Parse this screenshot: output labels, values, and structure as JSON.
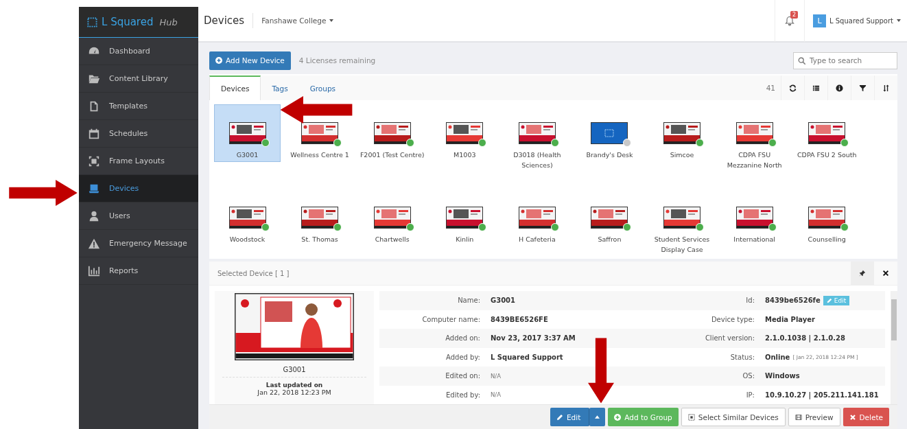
{
  "brand": {
    "name": "L Squared",
    "suffix": "Hub"
  },
  "sidebar": {
    "items": [
      {
        "label": "Dashboard",
        "selected": false
      },
      {
        "label": "Content Library",
        "selected": false
      },
      {
        "label": "Templates",
        "selected": false
      },
      {
        "label": "Schedules",
        "selected": false
      },
      {
        "label": "Frame Layouts",
        "selected": false
      },
      {
        "label": "Devices",
        "selected": true
      },
      {
        "label": "Users",
        "selected": false
      },
      {
        "label": "Emergency Message",
        "selected": false
      },
      {
        "label": "Reports",
        "selected": false
      }
    ]
  },
  "header": {
    "title": "Devices",
    "org": "Fanshawe College",
    "notifications": "2",
    "avatar": "L",
    "user": "L Squared Support"
  },
  "toolbar": {
    "add_button": "Add New Device",
    "licenses": "4 Licenses remaining",
    "search": {
      "placeholder": "Type to search"
    }
  },
  "tabs": [
    {
      "label": "Devices",
      "selected": true
    },
    {
      "label": "Tags",
      "selected": false
    },
    {
      "label": "Groups",
      "selected": false
    }
  ],
  "count": "41",
  "devices": [
    {
      "name": "G3001",
      "online": true,
      "selected": true
    },
    {
      "name": "Wellness Centre 1",
      "online": true,
      "selected": false
    },
    {
      "name": "F2001 (Test Centre)",
      "online": true,
      "selected": false
    },
    {
      "name": "M1003",
      "online": true,
      "selected": false
    },
    {
      "name": "D3018 (Health Sciences)",
      "online": true,
      "selected": false
    },
    {
      "name": "Brandy's Desk",
      "online": false,
      "selected": false
    },
    {
      "name": "Simcoe",
      "online": true,
      "selected": false
    },
    {
      "name": "CDPA FSU Mezzanine North",
      "online": true,
      "selected": false
    },
    {
      "name": "CDPA FSU 2 South",
      "online": true,
      "selected": false
    },
    {
      "name": "Woodstock",
      "online": true,
      "selected": false
    },
    {
      "name": "St. Thomas",
      "online": true,
      "selected": false
    },
    {
      "name": "Chartwells",
      "online": true,
      "selected": false
    },
    {
      "name": "Kinlin",
      "online": true,
      "selected": false
    },
    {
      "name": "H Cafeteria",
      "online": true,
      "selected": false
    },
    {
      "name": "Saffron",
      "online": true,
      "selected": false
    },
    {
      "name": "Student Services Display Case",
      "online": true,
      "selected": false
    },
    {
      "name": "International",
      "online": true,
      "selected": false
    },
    {
      "name": "Counselling",
      "online": true,
      "selected": false
    }
  ],
  "selected_panel": {
    "title": "Selected Device [ 1 ]",
    "device_name": "G3001",
    "updated_label": "Last updated on",
    "updated": "Jan 22, 2018 12:23 PM",
    "left_fields": [
      {
        "label": "Name:",
        "value": "G3001",
        "muted": false
      },
      {
        "label": "Computer name:",
        "value": "8439BE6526FE",
        "muted": false
      },
      {
        "label": "Added on:",
        "value": "Nov 23, 2017 3:37 AM",
        "muted": false
      },
      {
        "label": "Added by:",
        "value": "L Squared Support",
        "muted": false
      },
      {
        "label": "Edited on:",
        "value": "N/A",
        "muted": true
      },
      {
        "label": "Edited by:",
        "value": "N/A",
        "muted": true
      }
    ],
    "right_fields": [
      {
        "label": "Id:",
        "value": "8439be6526fe",
        "muted": false,
        "button": "Edit"
      },
      {
        "label": "Device type:",
        "value": "Media Player",
        "muted": false
      },
      {
        "label": "Client version:",
        "value": "2.1.0.1038 | 2.1.0.28",
        "muted": false
      },
      {
        "label": "Status:",
        "value": "Online",
        "muted": false,
        "note": "[ Jan 22, 2018 12:24 PM ]"
      },
      {
        "label": "OS:",
        "value": "Windows",
        "muted": false
      },
      {
        "label": "IP:",
        "value": "10.9.10.27 | 205.211.141.181",
        "muted": false
      }
    ]
  },
  "actions": [
    {
      "label": "Edit",
      "kind": "edit"
    },
    {
      "label": "Add to Group",
      "kind": "group"
    },
    {
      "label": "Select Similar Devices",
      "kind": "similar"
    },
    {
      "label": "Preview",
      "kind": "preview"
    },
    {
      "label": "Delete",
      "kind": "delete"
    }
  ]
}
